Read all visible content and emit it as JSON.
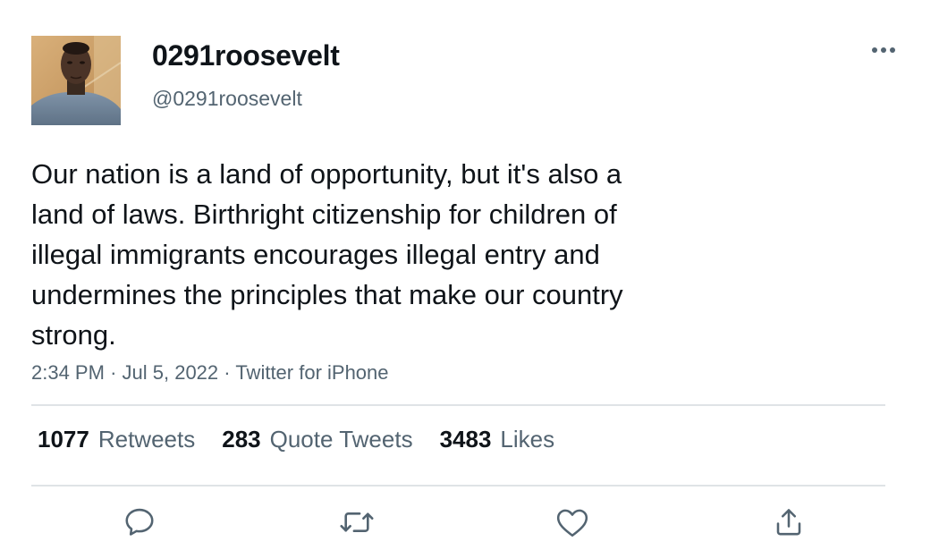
{
  "tweet": {
    "display_name": "0291roosevelt",
    "handle": "@0291roosevelt",
    "text": "Our nation is a land of opportunity, but it's also a\nland of laws. Birthright citizenship for children of\nillegal immigrants encourages illegal entry and\nundermines the principles that make our country\nstrong.",
    "time": "2:34 PM",
    "separator": "·",
    "date": "Jul 5, 2022",
    "source": "Twitter for iPhone"
  },
  "stats": {
    "retweets_count": "1077",
    "retweets_label": "Retweets",
    "quote_tweets_count": "283",
    "quote_tweets_label": "Quote Tweets",
    "likes_count": "3483",
    "likes_label": "Likes"
  },
  "icons": {
    "more": "more-horizontal-icon",
    "reply": "reply-icon",
    "retweet": "retweet-icon",
    "like": "heart-icon",
    "share": "share-icon"
  },
  "colors": {
    "text_primary": "#0f1419",
    "text_secondary": "#536471",
    "divider": "#dfe3e6"
  }
}
